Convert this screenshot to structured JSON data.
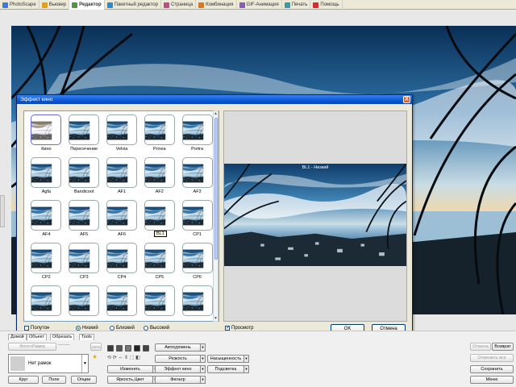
{
  "tabs": [
    {
      "label": "PhotoScape",
      "color": "#3a7bd5"
    },
    {
      "label": "Вьювер",
      "color": "#e0a020"
    },
    {
      "label": "Редактор",
      "color": "#4a9a3a",
      "active": true
    },
    {
      "label": "Пакетный редактор",
      "color": "#2a8ad0"
    },
    {
      "label": "Страница",
      "color": "#c04a8a"
    },
    {
      "label": "Комбинация",
      "color": "#d07a2a"
    },
    {
      "label": "GIF-Анимация",
      "color": "#8a5ac0"
    },
    {
      "label": "Печать",
      "color": "#3a9aaa"
    },
    {
      "label": "Помощь",
      "color": "#d03030"
    }
  ],
  "dialog": {
    "title": "Эффект кино",
    "close": "X",
    "preview_caption": "BL1 - Низкий",
    "tooltip": "BL1",
    "items": [
      "Кино",
      "Пересечение",
      "Velvia",
      "Provia",
      "Portra",
      "Agfa",
      "Bandicoot",
      "AF1",
      "AF2",
      "AF3",
      "AF4",
      "AF5",
      "AF6",
      "BL1",
      "CP1",
      "CP2",
      "CP3",
      "CP4",
      "CP5",
      "CP6",
      "",
      "",
      "",
      "",
      ""
    ],
    "options": {
      "halftone": "Полутон",
      "low": "Низкий",
      "near": "Близкий",
      "high": "Высокий",
      "preview": "Просмотр"
    },
    "ok": "OK",
    "cancel": "Отмена"
  },
  "toolbar": {
    "panel_tabs": [
      "Домой",
      "Объект",
      "Обрезать",
      "Tools"
    ],
    "photo_frame": "Фото+Рамка",
    "zoom": "100%",
    "frame_select": "Нет рамок",
    "circle": "Круг",
    "field": "Поле",
    "options": "Опции",
    "autolevel": "Автоуровень",
    "sharpness": "Резкость",
    "saturation": "Насыщенность",
    "change": "Изменить",
    "film_effect": "Эффект кино",
    "backlight": "Подсветка",
    "brightness": "Яркость,Цвет",
    "filter": "Фильтр",
    "undo": "Отмена",
    "redo": "Возврат",
    "undo_all": "Отменить все",
    "save": "Сохранить",
    "menu": "Меню"
  }
}
